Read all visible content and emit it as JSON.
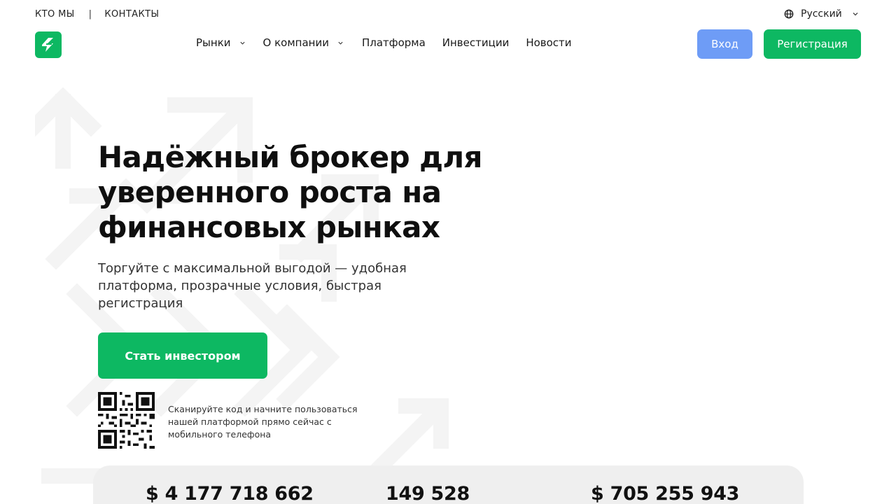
{
  "utility": {
    "who_we_are": "КТО МЫ",
    "separator": "|",
    "contacts": "КОНТАКТЫ"
  },
  "language": {
    "icon": "globe-icon",
    "selected": "Русский"
  },
  "header": {
    "logo_icon": "lightning-logo-icon",
    "nav": [
      {
        "label": "Рынки",
        "has_dropdown": true
      },
      {
        "label": "О компании",
        "has_dropdown": true
      },
      {
        "label": "Платформа",
        "has_dropdown": false
      },
      {
        "label": "Инвестиции",
        "has_dropdown": false
      },
      {
        "label": "Новости",
        "has_dropdown": false
      }
    ],
    "login_label": "Вход",
    "register_label": "Регистрация"
  },
  "hero": {
    "title": "Надёжный брокер для уверенного роста на финансовых рынках",
    "subtitle": "Торгуйте с максимальной выгодой — удобная платформа, прозрачные условия, быстрая регистрация",
    "cta_label": "Стать инвестором",
    "qr_icon": "qr-code-icon",
    "qr_text": "Сканируйте код и начните пользоваться нашей платформой прямо сейчас с мобильного телефона"
  },
  "stats": [
    {
      "value": "$ 4 177 718 662"
    },
    {
      "value": "149 528"
    },
    {
      "value": "$ 705 255 943"
    }
  ],
  "colors": {
    "brand_green": "#0db862",
    "login_blue": "#6e9cf6",
    "stats_bg": "#efefef"
  }
}
